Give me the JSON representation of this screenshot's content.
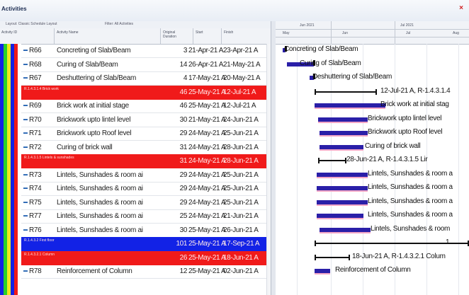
{
  "window": {
    "title": "Activities",
    "close_glyph": "×"
  },
  "subbar": {
    "layout_label": "Layout: Classic Schedule Layout",
    "filter_label": "Filter: All Activities"
  },
  "columns": {
    "wbs": "Activity ID",
    "name": "Activity Name",
    "duration": "Original Duration",
    "start": "Start",
    "finish": "Finish"
  },
  "timeline": {
    "top": [
      "Jun 2021",
      "Jul 2021"
    ],
    "bottom": [
      "May",
      "Jun",
      "Jul",
      "Aug"
    ]
  },
  "rows": [
    {
      "kind": "act",
      "id": "R66",
      "name": "Concreting of Slab/Beam",
      "dur": "3",
      "start": "21-Apr-21 A",
      "fin": "23-Apr-21 A",
      "gantt_label": "Concreting of Slab/Beam"
    },
    {
      "kind": "act",
      "id": "R68",
      "name": "Curing of Slab/Beam",
      "dur": "14",
      "start": "26-Apr-21 A",
      "fin": "21-May-21 A",
      "gantt_label": "Curing of Slab/Beam"
    },
    {
      "kind": "act",
      "id": "R67",
      "name": "Deshuttering of Slab/Beam",
      "dur": "4",
      "start": "17-May-21 A",
      "fin": "20-May-21 A",
      "gantt_label": "Deshuttering of Slab/Beam"
    },
    {
      "kind": "band",
      "color": "red",
      "band_id": "R.1.4.3.1.4  Brick work",
      "name": "",
      "dur": "46",
      "start": "25-May-21 A",
      "fin": "12-Jul-21 A",
      "gantt_label": "12-Jul-21 A, R-1.4.3.1.4"
    },
    {
      "kind": "act",
      "id": "R69",
      "name": "Brick work at initial stage",
      "dur": "46",
      "start": "25-May-21 A",
      "fin": "12-Jul-21 A",
      "gantt_label": "Brick work at initial stag"
    },
    {
      "kind": "act",
      "id": "R70",
      "name": "Brickwork upto lintel level",
      "dur": "30",
      "start": "21-May-21 A",
      "fin": "24-Jun-21 A",
      "gantt_label": "Brickwork upto lintel level"
    },
    {
      "kind": "act",
      "id": "R71",
      "name": "Brickwork upto Roof level",
      "dur": "29",
      "start": "24-May-21 A",
      "fin": "25-Jun-21 A",
      "gantt_label": "Brickwork upto Roof level"
    },
    {
      "kind": "act",
      "id": "R72",
      "name": "Curing of brick wall",
      "dur": "31",
      "start": "24-May-21 A",
      "fin": "28-Jun-21 A",
      "gantt_label": "Curing of brick wall"
    },
    {
      "kind": "band",
      "color": "red",
      "band_id": "R.1.4.3.1.5  Lintels & sunshades",
      "name": "",
      "dur": "31",
      "start": "24-May-21 A",
      "fin": "28-Jun-21 A",
      "gantt_label": "28-Jun-21 A, R-1.4.3.1.5  Lir"
    },
    {
      "kind": "act",
      "id": "R73",
      "name": "Lintels, Sunshades & room ai",
      "dur": "29",
      "start": "24-May-21 A",
      "fin": "25-Jun-21 A",
      "gantt_label": "Lintels, Sunshades & room a"
    },
    {
      "kind": "act",
      "id": "R74",
      "name": "Lintels, Sunshades & room ai",
      "dur": "29",
      "start": "24-May-21 A",
      "fin": "25-Jun-21 A",
      "gantt_label": "Lintels, Sunshades & room a"
    },
    {
      "kind": "act",
      "id": "R75",
      "name": "Lintels, Sunshades & room ai",
      "dur": "29",
      "start": "24-May-21 A",
      "fin": "25-Jun-21 A",
      "gantt_label": "Lintels, Sunshades & room a"
    },
    {
      "kind": "act",
      "id": "R77",
      "name": "Lintels, Sunshades & room ai",
      "dur": "25",
      "start": "24-May-21 A",
      "fin": "21-Jun-21 A",
      "gantt_label": "Lintels, Sunshades & room a"
    },
    {
      "kind": "act",
      "id": "R76",
      "name": "Lintels, Sunshades & room ai",
      "dur": "30",
      "start": "25-May-21 A",
      "fin": "26-Jun-21 A",
      "gantt_label": "Lintels, Sunshades & room"
    },
    {
      "kind": "band",
      "color": "blue",
      "band_id": "R.1.4.3.2  First floor",
      "name": "",
      "dur": "101",
      "start": "25-May-21 A",
      "fin": "17-Sep-21 A",
      "gantt_label": "1"
    },
    {
      "kind": "band",
      "color": "red",
      "band_id": "R.1.4.3.2.1  Column",
      "name": "",
      "dur": "26",
      "start": "25-May-21 A",
      "fin": "18-Jun-21 A",
      "gantt_label": "18-Jun-21 A, R-1.4.3.2.1  Colum"
    },
    {
      "kind": "act",
      "id": "R78",
      "name": "Reinforcement of Column",
      "dur": "12",
      "start": "25-May-21 A",
      "fin": "02-Jun-21 A",
      "gantt_label": "Reinforcement of Column"
    }
  ]
}
